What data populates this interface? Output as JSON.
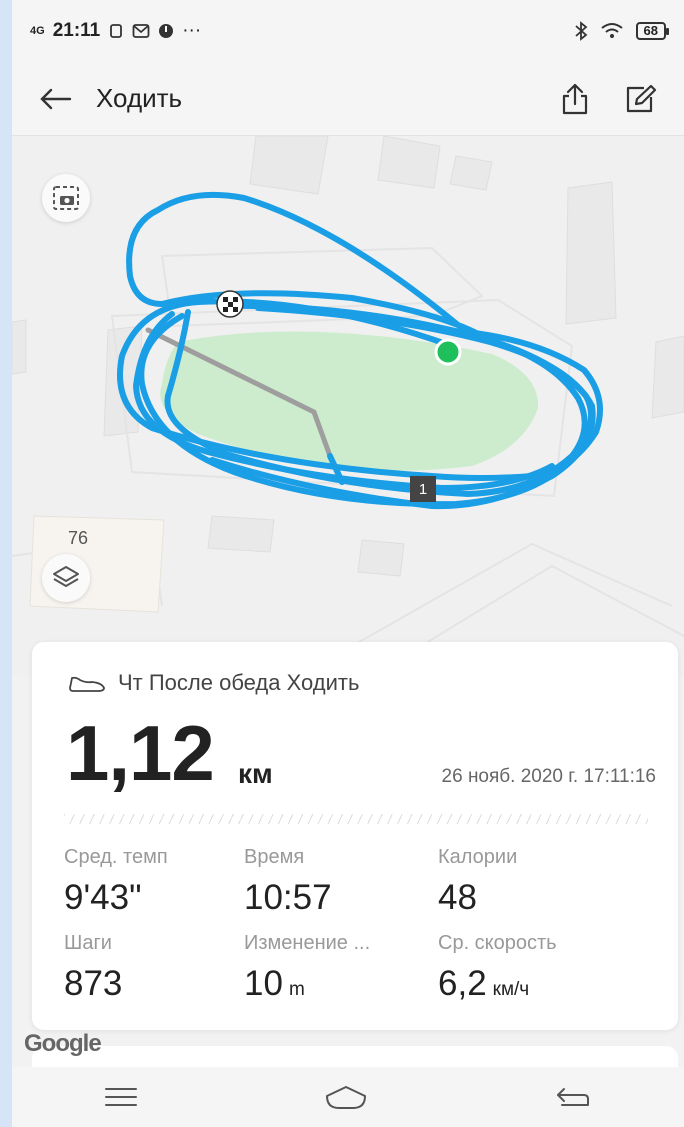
{
  "status_bar": {
    "network": "4G",
    "time": "21:11",
    "notification_icons": [
      "sim-icon",
      "mail-icon",
      "dot-icon"
    ],
    "more": "···",
    "battery": "68"
  },
  "header": {
    "title": "Ходить",
    "back_icon": "arrow-left-icon",
    "share_icon": "share-icon",
    "edit_icon": "edit-icon"
  },
  "map": {
    "house_number": "76",
    "split_marker": "1",
    "route_color": "#1a9ee6",
    "area_color": "#cdeccd",
    "start_color": "#1fbf5c",
    "screenshot_icon": "camera-icon",
    "layers_icon": "layers-icon",
    "attribution": "Google"
  },
  "workout": {
    "activity_icon": "shoe-icon",
    "activity_title": "Чт После обеда Ходить",
    "distance": "1,12",
    "distance_unit": "км",
    "datetime": "26 нояб. 2020 г. 17:11:16",
    "stats": [
      {
        "label": "Сред. темп",
        "value": "9'43\"",
        "unit": ""
      },
      {
        "label": "Время",
        "value": "10:57",
        "unit": ""
      },
      {
        "label": "Калории",
        "value": "48",
        "unit": ""
      },
      {
        "label": "Шаги",
        "value": "873",
        "unit": ""
      },
      {
        "label": "Изменение ...",
        "value": "10",
        "unit": "m"
      },
      {
        "label": "Ср. скорость",
        "value": "6,2",
        "unit": "км/ч"
      }
    ]
  },
  "nav_bar": {
    "menu_icon": "menu-icon",
    "home_icon": "home-icon",
    "back_icon": "back-icon"
  }
}
